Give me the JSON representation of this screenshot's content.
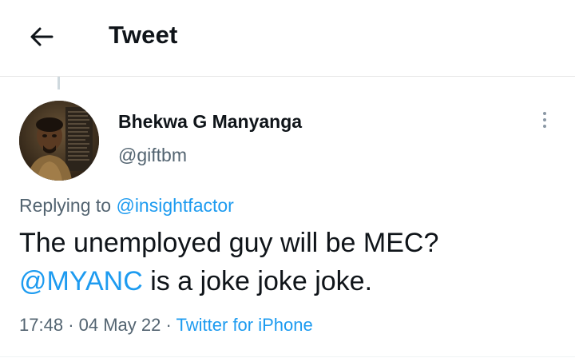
{
  "header": {
    "back_icon": "arrow-left-icon",
    "title": "Tweet"
  },
  "tweet": {
    "author": {
      "display_name": "Bhekwa G Manyanga",
      "handle": "@giftbm",
      "avatar_icon": "profile-photo"
    },
    "more_icon": "vertical-ellipsis-icon",
    "replying_to": {
      "prefix": "Replying to",
      "mention": "@insightfactor"
    },
    "text": {
      "line1": "The unemployed guy will be MEC?",
      "mention": "@MYANC",
      "line2_rest": " is a joke joke joke."
    },
    "meta": {
      "time": "17:48",
      "separator": "·",
      "date": "04 May 22",
      "source": "Twitter for iPhone"
    }
  },
  "colors": {
    "link": "#1d9bf0",
    "secondary_text": "#536471",
    "primary_text": "#0f1419",
    "divider": "#e6e6e6"
  }
}
